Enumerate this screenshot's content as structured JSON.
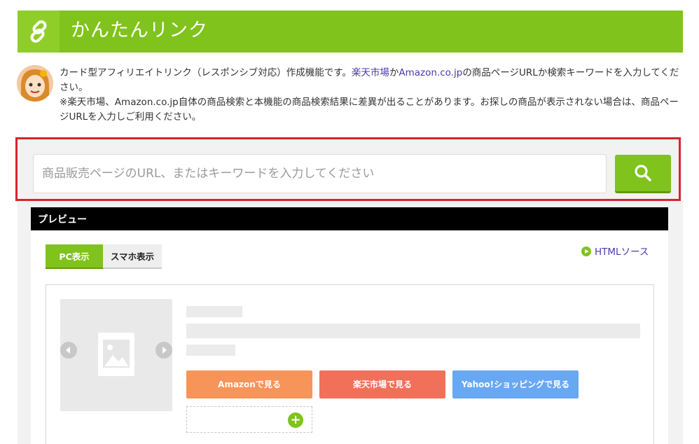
{
  "header": {
    "title": "かんたんリンク"
  },
  "intro": {
    "line1_pre": "カード型アフィリエイトリンク（レスポンシブ対応）作成機能です。",
    "link_rakuten": "楽天市場",
    "mid": "か",
    "link_amazon": "Amazon.co.jp",
    "line1_post": "の商品ページURLか検索キーワードを入力してください。",
    "note": "※楽天市場、Amazon.co.jp自体の商品検索と本機能の商品検索結果に差異が出ることがあります。お探しの商品が表示されない場合は、商品ページURLを入力しご利用ください。"
  },
  "search": {
    "placeholder": "商品販売ページのURL、またはキーワードを入力してください",
    "value": ""
  },
  "preview": {
    "heading": "プレビュー",
    "tabs": [
      {
        "label": "PC表示",
        "active": true
      },
      {
        "label": "スマホ表示",
        "active": false
      }
    ],
    "html_source_label": "HTMLソース",
    "buttons": {
      "amazon": "Amazonで見る",
      "rakuten": "楽天市場で見る",
      "yahoo": "Yahoo!ショッピングで見る"
    },
    "add_label": "+"
  },
  "colors": {
    "brand_green": "#80c31c",
    "highlight_red": "#d9232d",
    "amazon": "#f7945a",
    "rakuten": "#f1705a",
    "yahoo": "#68a8f2",
    "link": "#4a3ab0"
  },
  "icons": {
    "header": "link-icon",
    "search": "search-icon",
    "html_source": "play-circle-icon",
    "image_placeholder": "image-icon",
    "prev": "chevron-left-icon",
    "next": "chevron-right-icon",
    "add": "plus-circle-icon"
  }
}
